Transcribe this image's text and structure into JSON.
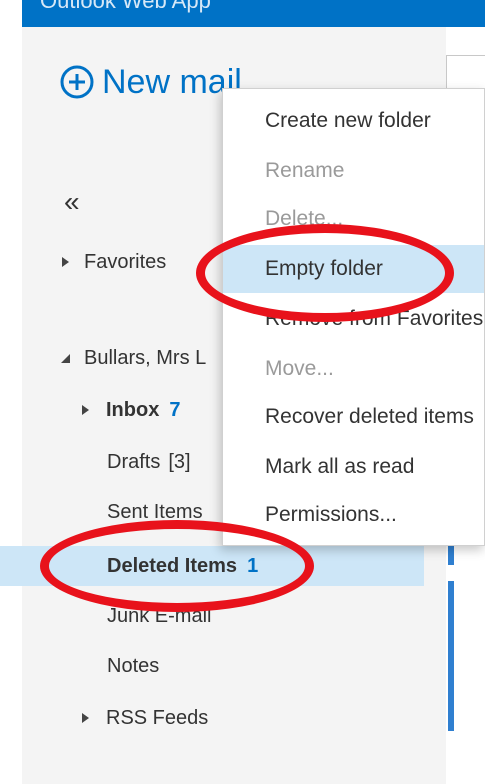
{
  "app": {
    "title": "Outlook Web App"
  },
  "colors": {
    "accent": "#0072c6",
    "selected_bg": "#cde6f7",
    "highlight_ring": "#e8121b"
  },
  "sidebar": {
    "new_mail_label": "New mail",
    "collapse_glyph": "«",
    "favorites_label": "Favorites",
    "account_label": "Bullars, Mrs L",
    "folders": {
      "inbox": {
        "label": "Inbox",
        "count": "7"
      },
      "drafts": {
        "label": "Drafts",
        "count": "[3]"
      },
      "sent": {
        "label": "Sent Items"
      },
      "deleted": {
        "label": "Deleted Items",
        "count": "1"
      },
      "junk": {
        "label": "Junk E-mail"
      },
      "notes": {
        "label": "Notes"
      },
      "rss": {
        "label": "RSS Feeds"
      }
    }
  },
  "context_menu": {
    "create_new_folder": "Create new folder",
    "rename": "Rename",
    "delete": "Delete...",
    "empty_folder": "Empty folder",
    "remove_from_favorites": "Remove from Favorites",
    "move": "Move...",
    "recover_deleted_items": "Recover deleted items",
    "mark_all_as_read": "Mark all as read",
    "permissions": "Permissions..."
  }
}
